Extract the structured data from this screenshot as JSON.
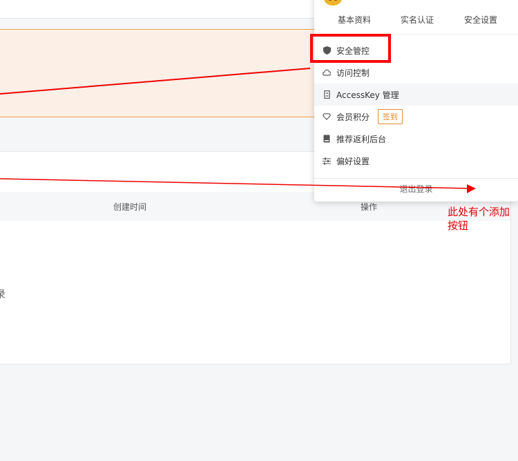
{
  "account_tabs": [
    "基本资料",
    "实名认证",
    "安全设置"
  ],
  "menu": [
    {
      "label": "安全管控",
      "icon": "shield-icon"
    },
    {
      "label": "访问控制",
      "icon": "cloud-icon"
    },
    {
      "label": "AccessKey 管理",
      "icon": "key-icon"
    },
    {
      "label": "会员积分",
      "icon": "diamond-icon",
      "badge": "签到"
    },
    {
      "label": "推荐返利后台",
      "icon": "book-icon"
    },
    {
      "label": "偏好设置",
      "icon": "sliders-icon"
    }
  ],
  "logout_label": "退出登录",
  "table": {
    "col_created": "创建时间",
    "col_action": "操作"
  },
  "empty_text": "录",
  "annotation": "此处有个添加按钮",
  "colors": {
    "annotation": "#ff0000",
    "badge": "#e8892b",
    "notice_bg": "#fbefe6",
    "notice_border": "#f0a14a"
  }
}
